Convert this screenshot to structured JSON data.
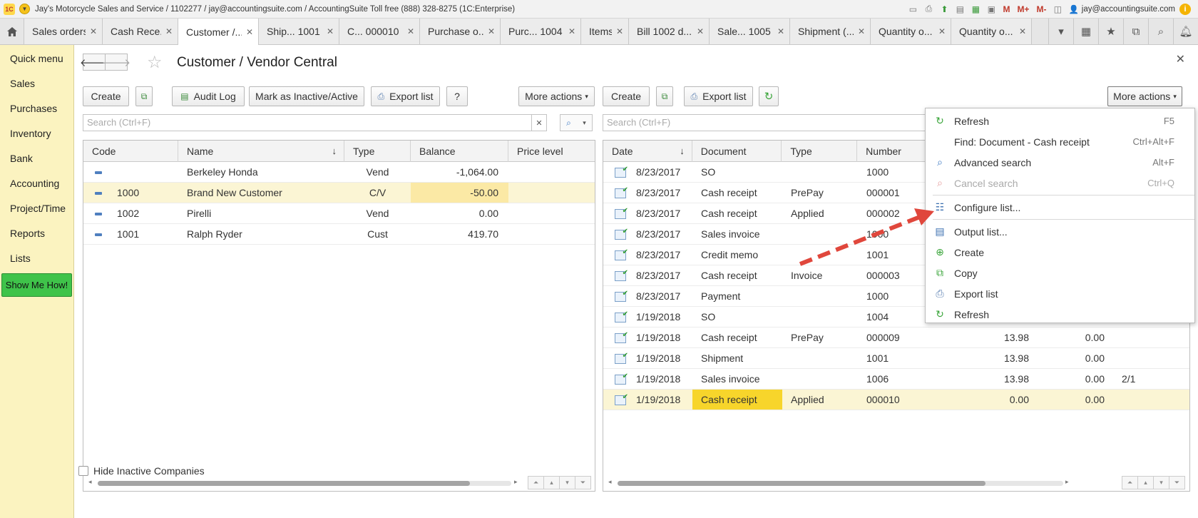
{
  "window": {
    "title": "Jay's Motorcycle Sales and Service / 1102277 / jay@accountingsuite.com / AccountingSuite Toll free (888) 328-8275   (1C:Enterprise)",
    "user": "jay@accountingsuite.com",
    "logo_text": "1C",
    "m_labels": [
      "M",
      "M+",
      "M-"
    ]
  },
  "tabs": [
    {
      "label": "Sales orders",
      "active": false
    },
    {
      "label": "Cash Rece...",
      "active": false
    },
    {
      "label": "Customer /...",
      "active": true
    },
    {
      "label": "Ship...   1001",
      "active": false
    },
    {
      "label": "C...   000010",
      "active": false
    },
    {
      "label": "Purchase o...",
      "active": false
    },
    {
      "label": "Purc...   1004",
      "active": false
    },
    {
      "label": "Items",
      "active": false
    },
    {
      "label": "Bill 1002 d...",
      "active": false
    },
    {
      "label": "Sale...   1005",
      "active": false
    },
    {
      "label": "Shipment (...",
      "active": false
    },
    {
      "label": "Quantity o...",
      "active": false
    },
    {
      "label": "Quantity o...",
      "active": false
    }
  ],
  "sidebar": {
    "items": [
      "Quick menu",
      "Sales",
      "Purchases",
      "Inventory",
      "Bank",
      "Accounting",
      "Project/Time",
      "Reports",
      "Lists"
    ],
    "show_me_how": "Show Me How!"
  },
  "form": {
    "title": "Customer / Vendor Central"
  },
  "left": {
    "toolbar": {
      "create": "Create",
      "audit_log": "Audit Log",
      "mark_inactive": "Mark as Inactive/Active",
      "export_list": "Export list",
      "help": "?",
      "more_actions": "More actions"
    },
    "search_placeholder": "Search (Ctrl+F)",
    "columns": [
      "Code",
      "Name",
      "Type",
      "Balance",
      "Price level"
    ],
    "rows": [
      {
        "code": "",
        "name": "Berkeley Honda",
        "type": "Vend",
        "balance": "-1,064.00",
        "price_level": ""
      },
      {
        "code": "1000",
        "name": "Brand New Customer",
        "type": "C/V",
        "balance": "-50.00",
        "price_level": ""
      },
      {
        "code": "1002",
        "name": "Pirelli",
        "type": "Vend",
        "balance": "0.00",
        "price_level": ""
      },
      {
        "code": "1001",
        "name": "Ralph Ryder",
        "type": "Cust",
        "balance": "419.70",
        "price_level": ""
      }
    ],
    "hide_inactive": "Hide Inactive Companies"
  },
  "right": {
    "toolbar": {
      "create": "Create",
      "export_list": "Export list",
      "more_actions": "More actions"
    },
    "search_placeholder": "Search (Ctrl+F)",
    "columns": [
      "Date",
      "Document",
      "Type",
      "Number"
    ],
    "rows": [
      {
        "date": "8/23/2017",
        "document": "SO",
        "type": "",
        "number": "1000",
        "c1": "",
        "c2": "",
        "c3": ""
      },
      {
        "date": "8/23/2017",
        "document": "Cash receipt",
        "type": "PrePay",
        "number": "000001",
        "c1": "",
        "c2": "",
        "c3": ""
      },
      {
        "date": "8/23/2017",
        "document": "Cash receipt",
        "type": "Applied",
        "number": "000002",
        "c1": "",
        "c2": "",
        "c3": ""
      },
      {
        "date": "8/23/2017",
        "document": "Sales invoice",
        "type": "",
        "number": "1000",
        "c1": "",
        "c2": "",
        "c3": ""
      },
      {
        "date": "8/23/2017",
        "document": "Credit memo",
        "type": "",
        "number": "1001",
        "c1": "",
        "c2": "",
        "c3": ""
      },
      {
        "date": "8/23/2017",
        "document": "Cash receipt",
        "type": "Invoice",
        "number": "000003",
        "c1": "",
        "c2": "",
        "c3": ""
      },
      {
        "date": "8/23/2017",
        "document": "Payment",
        "type": "",
        "number": "1000",
        "c1": "",
        "c2": "",
        "c3": ""
      },
      {
        "date": "1/19/2018",
        "document": "SO",
        "type": "",
        "number": "1004",
        "c1": "",
        "c2": "",
        "c3": ""
      },
      {
        "date": "1/19/2018",
        "document": "Cash receipt",
        "type": "PrePay",
        "number": "000009",
        "c1": "13.98",
        "c2": "0.00",
        "c3": ""
      },
      {
        "date": "1/19/2018",
        "document": "Shipment",
        "type": "",
        "number": "1001",
        "c1": "13.98",
        "c2": "0.00",
        "c3": ""
      },
      {
        "date": "1/19/2018",
        "document": "Sales invoice",
        "type": "",
        "number": "1006",
        "c1": "13.98",
        "c2": "0.00",
        "c3": "2/1"
      },
      {
        "date": "1/19/2018",
        "document": "Cash receipt",
        "type": "Applied",
        "number": "000010",
        "c1": "0.00",
        "c2": "0.00",
        "c3": ""
      }
    ]
  },
  "menu": {
    "items": [
      {
        "label": "Refresh",
        "key": "F5",
        "icon": "refresh-icon",
        "disabled": false
      },
      {
        "label": "Find: Document - Cash receipt",
        "key": "Ctrl+Alt+F",
        "icon": "",
        "disabled": false
      },
      {
        "label": "Advanced search",
        "key": "Alt+F",
        "icon": "advanced-search-icon",
        "disabled": false
      },
      {
        "label": "Cancel search",
        "key": "Ctrl+Q",
        "icon": "cancel-search-icon",
        "disabled": true
      },
      {
        "label": "Configure list...",
        "key": "",
        "icon": "configure-list-icon",
        "disabled": false
      },
      {
        "label": "Output list...",
        "key": "",
        "icon": "output-list-icon",
        "disabled": false
      },
      {
        "label": "Create",
        "key": "",
        "icon": "create-icon",
        "disabled": false
      },
      {
        "label": "Copy",
        "key": "",
        "icon": "copy-icon",
        "disabled": false
      },
      {
        "label": "Export list",
        "key": "",
        "icon": "export-list-icon",
        "disabled": false
      },
      {
        "label": "Refresh",
        "key": "",
        "icon": "refresh-icon",
        "disabled": false
      }
    ]
  },
  "colors": {
    "sidebar_bg": "#fbf3c0",
    "show_me_how": "#3fc34a",
    "selected_row": "#fbf5d4",
    "highlight_cell": "#f7d52b",
    "arrow": "#e0473c"
  }
}
